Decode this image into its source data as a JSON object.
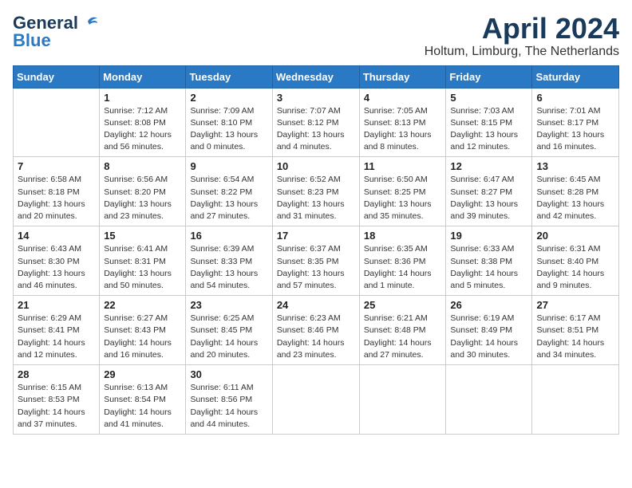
{
  "logo": {
    "general": "General",
    "blue": "Blue"
  },
  "title": "April 2024",
  "location": "Holtum, Limburg, The Netherlands",
  "weekdays": [
    "Sunday",
    "Monday",
    "Tuesday",
    "Wednesday",
    "Thursday",
    "Friday",
    "Saturday"
  ],
  "weeks": [
    [
      {
        "day": "",
        "sunrise": "",
        "sunset": "",
        "daylight": ""
      },
      {
        "day": "1",
        "sunrise": "Sunrise: 7:12 AM",
        "sunset": "Sunset: 8:08 PM",
        "daylight": "Daylight: 12 hours and 56 minutes."
      },
      {
        "day": "2",
        "sunrise": "Sunrise: 7:09 AM",
        "sunset": "Sunset: 8:10 PM",
        "daylight": "Daylight: 13 hours and 0 minutes."
      },
      {
        "day": "3",
        "sunrise": "Sunrise: 7:07 AM",
        "sunset": "Sunset: 8:12 PM",
        "daylight": "Daylight: 13 hours and 4 minutes."
      },
      {
        "day": "4",
        "sunrise": "Sunrise: 7:05 AM",
        "sunset": "Sunset: 8:13 PM",
        "daylight": "Daylight: 13 hours and 8 minutes."
      },
      {
        "day": "5",
        "sunrise": "Sunrise: 7:03 AM",
        "sunset": "Sunset: 8:15 PM",
        "daylight": "Daylight: 13 hours and 12 minutes."
      },
      {
        "day": "6",
        "sunrise": "Sunrise: 7:01 AM",
        "sunset": "Sunset: 8:17 PM",
        "daylight": "Daylight: 13 hours and 16 minutes."
      }
    ],
    [
      {
        "day": "7",
        "sunrise": "Sunrise: 6:58 AM",
        "sunset": "Sunset: 8:18 PM",
        "daylight": "Daylight: 13 hours and 20 minutes."
      },
      {
        "day": "8",
        "sunrise": "Sunrise: 6:56 AM",
        "sunset": "Sunset: 8:20 PM",
        "daylight": "Daylight: 13 hours and 23 minutes."
      },
      {
        "day": "9",
        "sunrise": "Sunrise: 6:54 AM",
        "sunset": "Sunset: 8:22 PM",
        "daylight": "Daylight: 13 hours and 27 minutes."
      },
      {
        "day": "10",
        "sunrise": "Sunrise: 6:52 AM",
        "sunset": "Sunset: 8:23 PM",
        "daylight": "Daylight: 13 hours and 31 minutes."
      },
      {
        "day": "11",
        "sunrise": "Sunrise: 6:50 AM",
        "sunset": "Sunset: 8:25 PM",
        "daylight": "Daylight: 13 hours and 35 minutes."
      },
      {
        "day": "12",
        "sunrise": "Sunrise: 6:47 AM",
        "sunset": "Sunset: 8:27 PM",
        "daylight": "Daylight: 13 hours and 39 minutes."
      },
      {
        "day": "13",
        "sunrise": "Sunrise: 6:45 AM",
        "sunset": "Sunset: 8:28 PM",
        "daylight": "Daylight: 13 hours and 42 minutes."
      }
    ],
    [
      {
        "day": "14",
        "sunrise": "Sunrise: 6:43 AM",
        "sunset": "Sunset: 8:30 PM",
        "daylight": "Daylight: 13 hours and 46 minutes."
      },
      {
        "day": "15",
        "sunrise": "Sunrise: 6:41 AM",
        "sunset": "Sunset: 8:31 PM",
        "daylight": "Daylight: 13 hours and 50 minutes."
      },
      {
        "day": "16",
        "sunrise": "Sunrise: 6:39 AM",
        "sunset": "Sunset: 8:33 PM",
        "daylight": "Daylight: 13 hours and 54 minutes."
      },
      {
        "day": "17",
        "sunrise": "Sunrise: 6:37 AM",
        "sunset": "Sunset: 8:35 PM",
        "daylight": "Daylight: 13 hours and 57 minutes."
      },
      {
        "day": "18",
        "sunrise": "Sunrise: 6:35 AM",
        "sunset": "Sunset: 8:36 PM",
        "daylight": "Daylight: 14 hours and 1 minute."
      },
      {
        "day": "19",
        "sunrise": "Sunrise: 6:33 AM",
        "sunset": "Sunset: 8:38 PM",
        "daylight": "Daylight: 14 hours and 5 minutes."
      },
      {
        "day": "20",
        "sunrise": "Sunrise: 6:31 AM",
        "sunset": "Sunset: 8:40 PM",
        "daylight": "Daylight: 14 hours and 9 minutes."
      }
    ],
    [
      {
        "day": "21",
        "sunrise": "Sunrise: 6:29 AM",
        "sunset": "Sunset: 8:41 PM",
        "daylight": "Daylight: 14 hours and 12 minutes."
      },
      {
        "day": "22",
        "sunrise": "Sunrise: 6:27 AM",
        "sunset": "Sunset: 8:43 PM",
        "daylight": "Daylight: 14 hours and 16 minutes."
      },
      {
        "day": "23",
        "sunrise": "Sunrise: 6:25 AM",
        "sunset": "Sunset: 8:45 PM",
        "daylight": "Daylight: 14 hours and 20 minutes."
      },
      {
        "day": "24",
        "sunrise": "Sunrise: 6:23 AM",
        "sunset": "Sunset: 8:46 PM",
        "daylight": "Daylight: 14 hours and 23 minutes."
      },
      {
        "day": "25",
        "sunrise": "Sunrise: 6:21 AM",
        "sunset": "Sunset: 8:48 PM",
        "daylight": "Daylight: 14 hours and 27 minutes."
      },
      {
        "day": "26",
        "sunrise": "Sunrise: 6:19 AM",
        "sunset": "Sunset: 8:49 PM",
        "daylight": "Daylight: 14 hours and 30 minutes."
      },
      {
        "day": "27",
        "sunrise": "Sunrise: 6:17 AM",
        "sunset": "Sunset: 8:51 PM",
        "daylight": "Daylight: 14 hours and 34 minutes."
      }
    ],
    [
      {
        "day": "28",
        "sunrise": "Sunrise: 6:15 AM",
        "sunset": "Sunset: 8:53 PM",
        "daylight": "Daylight: 14 hours and 37 minutes."
      },
      {
        "day": "29",
        "sunrise": "Sunrise: 6:13 AM",
        "sunset": "Sunset: 8:54 PM",
        "daylight": "Daylight: 14 hours and 41 minutes."
      },
      {
        "day": "30",
        "sunrise": "Sunrise: 6:11 AM",
        "sunset": "Sunset: 8:56 PM",
        "daylight": "Daylight: 14 hours and 44 minutes."
      },
      {
        "day": "",
        "sunrise": "",
        "sunset": "",
        "daylight": ""
      },
      {
        "day": "",
        "sunrise": "",
        "sunset": "",
        "daylight": ""
      },
      {
        "day": "",
        "sunrise": "",
        "sunset": "",
        "daylight": ""
      },
      {
        "day": "",
        "sunrise": "",
        "sunset": "",
        "daylight": ""
      }
    ]
  ]
}
